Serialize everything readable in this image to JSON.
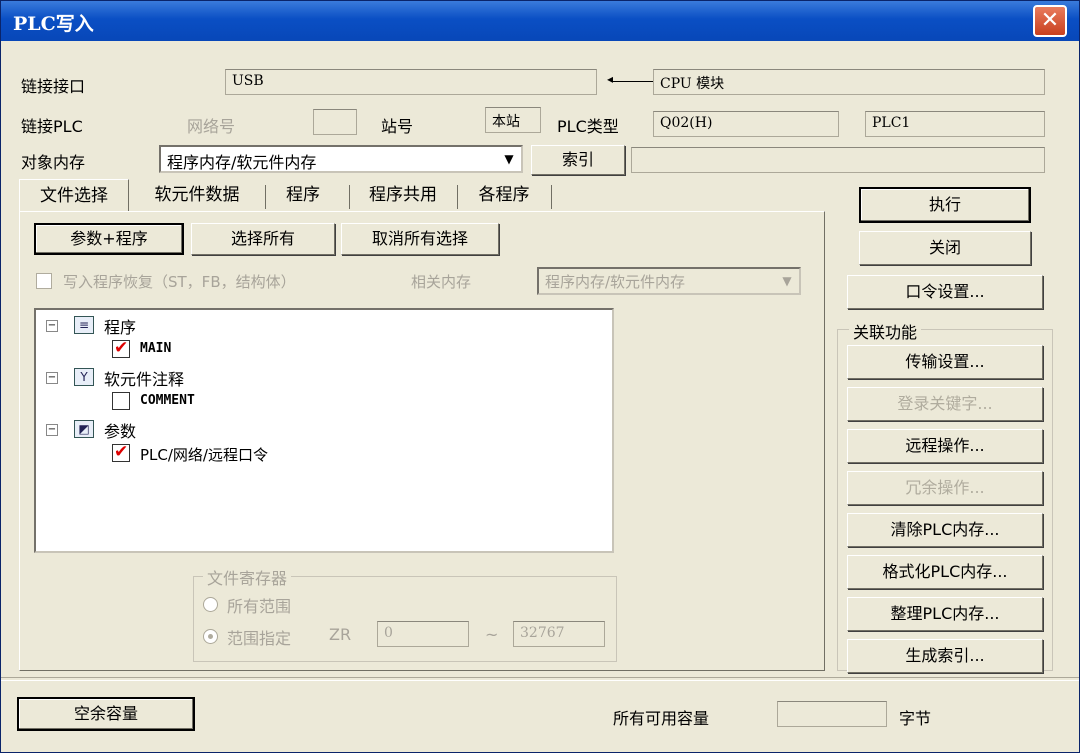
{
  "window": {
    "title": "PLC写入",
    "close_label": "✕"
  },
  "connection": {
    "interface_label": "链接接口",
    "interface_value": "USB",
    "target_value": "CPU 模块",
    "plc_label": "链接PLC",
    "network_label": "网络号",
    "network_value": "",
    "station_label": "站号",
    "station_value": "本站",
    "plc_type_label": "PLC类型",
    "plc_type_value": "Q02(H)",
    "plc_name_value": "PLC1"
  },
  "target_memory": {
    "label": "对象内存",
    "value": "程序内存/软元件内存",
    "index_button": "索引",
    "index_value": ""
  },
  "tabs": [
    "文件选择",
    "软元件数据",
    "程序",
    "程序共用",
    "各程序"
  ],
  "file_select": {
    "btn_param_program": "参数+程序",
    "btn_select_all": "选择所有",
    "btn_deselect_all": "取消所有选择",
    "checkbox_label": "写入程序恢复（ST，FB，结构体）",
    "related_memory_label": "相关内存",
    "related_memory_value": "程序内存/软元件内存"
  },
  "tree": [
    {
      "label": "程序",
      "expander": "−",
      "icon": "program-icon",
      "child": "MAIN",
      "child_checked": true
    },
    {
      "label": "软元件注释",
      "expander": "−",
      "icon": "comment-icon",
      "child": "COMMENT",
      "child_checked": false
    },
    {
      "label": "参数",
      "expander": "−",
      "icon": "parameter-icon",
      "child": "PLC/网络/远程口令",
      "child_checked": true
    }
  ],
  "file_register": {
    "title": "文件寄存器",
    "opt_all": "所有范围",
    "opt_range": "范围指定",
    "zr_label": "ZR",
    "from_value": "0",
    "tilde": "~",
    "to_value": "32767"
  },
  "actions": {
    "execute": "执行",
    "close": "关闭",
    "password": "口令设置...",
    "related_title": "关联功能",
    "transfer_setup": "传输设置...",
    "keyword": "登录关键字...",
    "remote_op": "远程操作...",
    "redundant_op": "冗余操作...",
    "clear_memory": "清除PLC内存...",
    "format_memory": "格式化PLC内存...",
    "arrange_memory": "整理PLC内存...",
    "create_index": "生成索引..."
  },
  "footer": {
    "free_space_button": "空余容量",
    "total_label": "所有可用容量",
    "total_value": "",
    "unit": "字节"
  }
}
